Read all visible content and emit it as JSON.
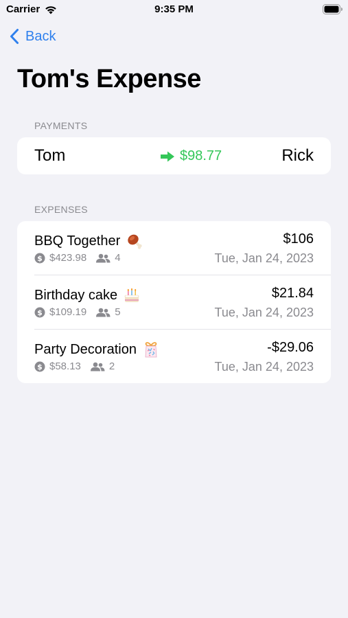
{
  "status_bar": {
    "carrier": "Carrier",
    "time": "9:35 PM"
  },
  "nav": {
    "back_label": "Back"
  },
  "page": {
    "title": "Tom's Expense"
  },
  "payments": {
    "header": "PAYMENTS",
    "from": "Tom",
    "amount": "$98.77",
    "to": "Rick",
    "accent": "#34c759"
  },
  "expenses": {
    "header": "EXPENSES",
    "items": [
      {
        "title": "BBQ Together",
        "icon": "meat-on-bone-icon",
        "total": "$423.98",
        "people": "4",
        "amount": "$106",
        "date": "Tue, Jan 24, 2023"
      },
      {
        "title": "Birthday cake",
        "icon": "birthday-cake-icon",
        "total": "$109.19",
        "people": "5",
        "amount": "$21.84",
        "date": "Tue, Jan 24, 2023"
      },
      {
        "title": "Party Decoration",
        "icon": "party-gift-icon",
        "total": "$58.13",
        "people": "2",
        "amount": "-$29.06",
        "date": "Tue, Jan 24, 2023"
      }
    ]
  },
  "colors": {
    "background": "#f2f2f7",
    "link": "#2f80ed",
    "secondary_text": "#8a8a8f"
  }
}
